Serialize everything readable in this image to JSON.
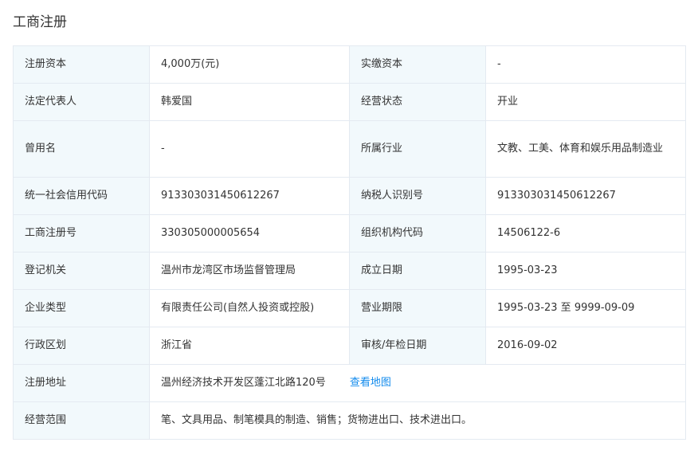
{
  "section": {
    "title": "工商注册"
  },
  "link_color": "#128bed",
  "label_bg": "#f2f9fc",
  "rows": [
    {
      "l1": "注册资本",
      "v1": "4,000万(元)",
      "l2": "实缴资本",
      "v2": "-"
    },
    {
      "l1": "法定代表人",
      "v1": "韩爱国",
      "l2": "经营状态",
      "v2": "开业"
    },
    {
      "l1": "曾用名",
      "v1": "-",
      "l2": "所属行业",
      "v2": "文教、工美、体育和娱乐用品制造业"
    },
    {
      "l1": "统一社会信用代码",
      "v1": "913303031450612267",
      "l2": "纳税人识别号",
      "v2": "913303031450612267"
    },
    {
      "l1": "工商注册号",
      "v1": "330305000005654",
      "l2": "组织机构代码",
      "v2": "14506122-6"
    },
    {
      "l1": "登记机关",
      "v1": "温州市龙湾区市场监督管理局",
      "l2": "成立日期",
      "v2": "1995-03-23"
    },
    {
      "l1": "企业类型",
      "v1": "有限责任公司(自然人投资或控股)",
      "l2": "营业期限",
      "v2": "1995-03-23 至 9999-09-09"
    },
    {
      "l1": "行政区划",
      "v1": "浙江省",
      "l2": "审核/年检日期",
      "v2": "2016-09-02"
    }
  ],
  "address": {
    "label": "注册地址",
    "value": "温州经济技术开发区蓬江北路120号",
    "map_link": "查看地图"
  },
  "scope": {
    "label": "经营范围",
    "value": "笔、文具用品、制笔模具的制造、销售；货物进出口、技术进出口。"
  }
}
